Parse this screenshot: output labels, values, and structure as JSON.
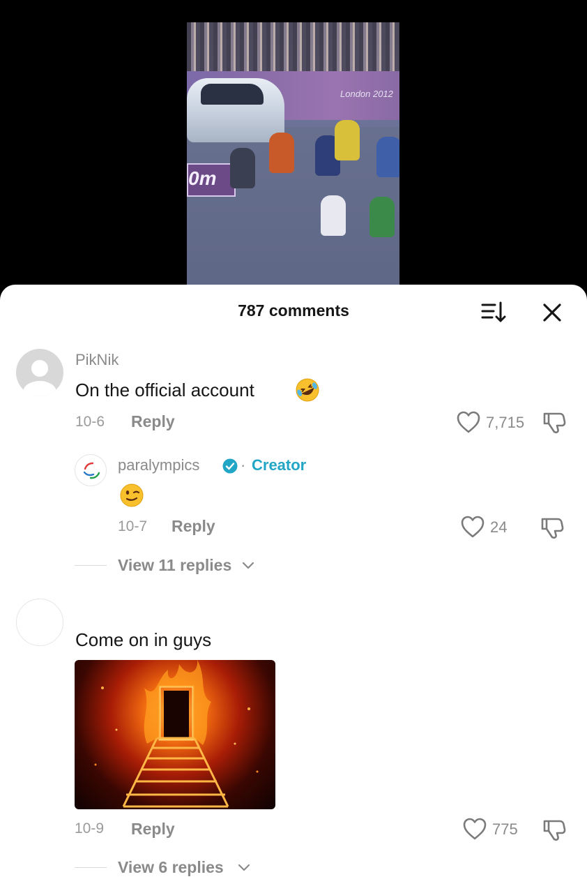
{
  "video": {
    "banner_text": "London 2012",
    "distance_sign": "0m"
  },
  "header": {
    "comment_count": "787 comments"
  },
  "comments": [
    {
      "username": "PikNik",
      "text": "On the official account",
      "emoji": "rolling-on-floor-laughing-emoji",
      "date": "10-6",
      "reply_label": "Reply",
      "likes": "7,715"
    },
    {
      "username": "paralympics",
      "separator": "·",
      "badge_label": "Creator",
      "emoji": "winking-face-emoji",
      "date": "10-7",
      "reply_label": "Reply",
      "likes": "24",
      "view_replies": "View 11 replies"
    },
    {
      "text": "Come on in guys",
      "image": "flaming-doorway-staircase-image",
      "date": "10-9",
      "reply_label": "Reply",
      "likes": "775",
      "view_replies": "View 6 replies"
    }
  ],
  "colors": {
    "accent_creator": "#22a6c6",
    "verified_badge": "#22a6c6",
    "muted_text": "#8a8a8a",
    "primary_text": "#161616"
  }
}
